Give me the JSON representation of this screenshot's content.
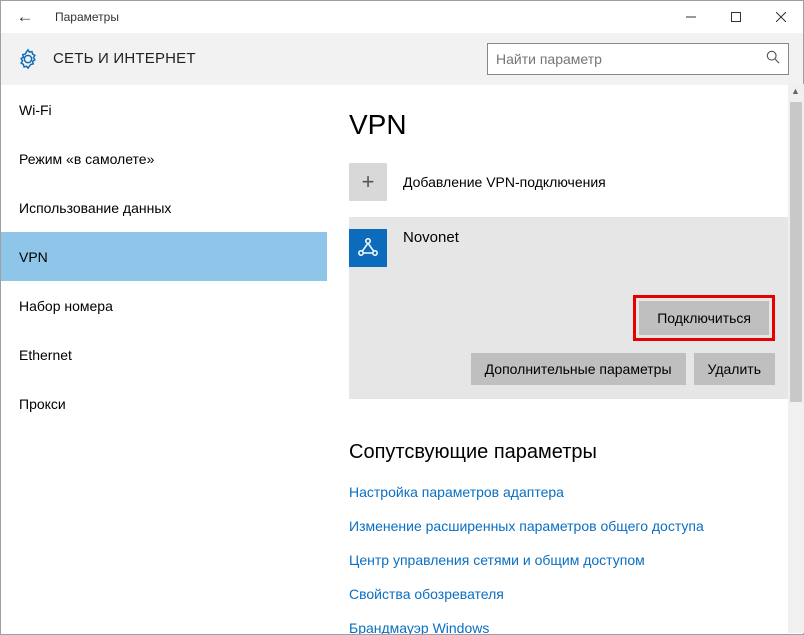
{
  "titlebar": {
    "title": "Параметры"
  },
  "header": {
    "section_title": "СЕТЬ И ИНТЕРНЕТ",
    "search_placeholder": "Найти параметр"
  },
  "sidebar": {
    "items": [
      {
        "label": "Wi-Fi",
        "selected": false
      },
      {
        "label": "Режим «в самолете»",
        "selected": false
      },
      {
        "label": "Использование данных",
        "selected": false
      },
      {
        "label": "VPN",
        "selected": true
      },
      {
        "label": "Набор номера",
        "selected": false
      },
      {
        "label": "Ethernet",
        "selected": false
      },
      {
        "label": "Прокси",
        "selected": false
      }
    ]
  },
  "main": {
    "heading": "VPN",
    "add_vpn_label": "Добавление VPN-подключения",
    "connection": {
      "name": "Novonet",
      "connect_label": "Подключиться",
      "advanced_label": "Дополнительные параметры",
      "delete_label": "Удалить"
    },
    "related": {
      "heading": "Сопутсвующие параметры",
      "links": [
        "Настройка параметров адаптера",
        "Изменение расширенных параметров общего доступа",
        "Центр управления сетями и общим доступом",
        "Свойства обозревателя",
        "Брандмауэр Windows"
      ]
    }
  }
}
